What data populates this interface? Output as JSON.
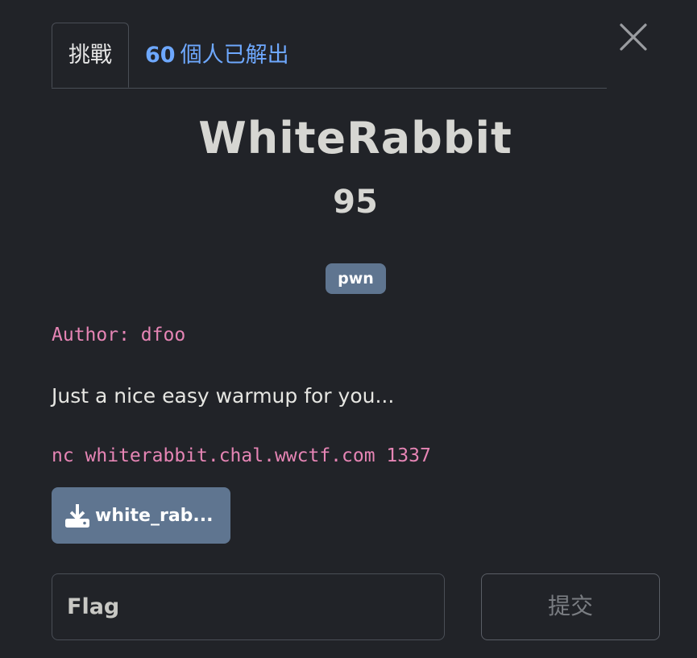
{
  "tabs": {
    "challenge_label": "挑戰",
    "solves_count": "60",
    "solves_label": "個人已解出"
  },
  "challenge": {
    "name": "WhiteRabbit",
    "points": "95",
    "category": "pwn",
    "author": "Author: dfoo",
    "description": "Just a nice easy warmup for you...",
    "connection": "nc whiterabbit.chal.wwctf.com 1337",
    "file_label": "white_rab..."
  },
  "form": {
    "flag_placeholder": "Flag",
    "flag_value": "",
    "submit_label": "提交"
  },
  "icons": {
    "close": "close-icon",
    "download": "download-icon"
  },
  "colors": {
    "background": "#212328",
    "accent_link": "#6ea8fe",
    "code_pink": "#e685b5",
    "badge_bg": "#5f7590"
  }
}
